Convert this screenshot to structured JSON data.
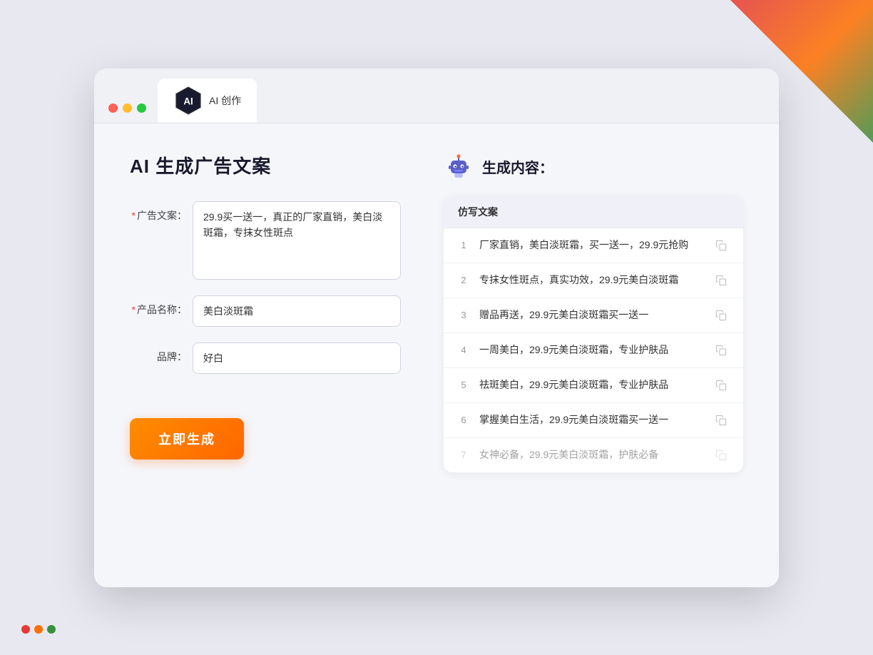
{
  "window": {
    "tab_label": "AI 创作",
    "controls": {
      "close": "close",
      "minimize": "minimize",
      "maximize": "maximize"
    }
  },
  "left_panel": {
    "title": "AI 生成广告文案",
    "form": {
      "ad_copy_label": "广告文案：",
      "ad_copy_required": "*",
      "ad_copy_value": "29.9买一送一，真正的厂家直销，美白淡斑霜，专抹女性斑点",
      "product_name_label": "产品名称：",
      "product_name_required": "*",
      "product_name_value": "美白淡斑霜",
      "brand_label": "品牌：",
      "brand_value": "好白"
    },
    "generate_button": "立即生成"
  },
  "right_panel": {
    "title": "生成内容：",
    "table_header": "仿写文案",
    "results": [
      {
        "num": "1",
        "text": "厂家直销，美白淡斑霜，买一送一，29.9元抢购"
      },
      {
        "num": "2",
        "text": "专抹女性斑点，真实功效，29.9元美白淡斑霜"
      },
      {
        "num": "3",
        "text": "赠品再送，29.9元美白淡斑霜买一送一"
      },
      {
        "num": "4",
        "text": "一周美白，29.9元美白淡斑霜，专业护肤品"
      },
      {
        "num": "5",
        "text": "祛斑美白，29.9元美白淡斑霜，专业护肤品"
      },
      {
        "num": "6",
        "text": "掌握美白生活，29.9元美白淡斑霜买一送一"
      },
      {
        "num": "7",
        "text": "女神必备，29.9元美白淡斑霜，护肤必备"
      }
    ]
  },
  "decorations": {
    "corner_dots": [
      "red",
      "yellow",
      "green"
    ]
  }
}
